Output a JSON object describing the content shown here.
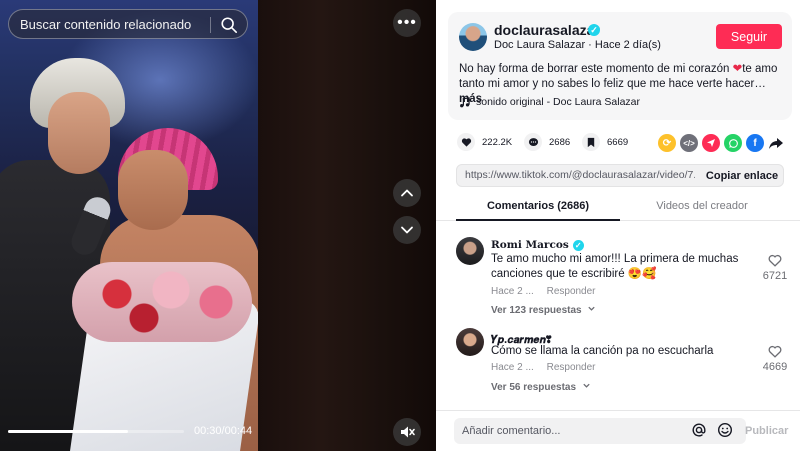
{
  "search": {
    "placeholder": "Buscar contenido relacionado"
  },
  "video": {
    "time": "00:30/00:44",
    "progress": 0.68
  },
  "author": {
    "username": "doclaurasalazar",
    "meta": "Doc Laura Salazar · Hace 2 día(s)",
    "follow_label": "Seguir"
  },
  "post": {
    "desc_part1": "No hay forma de borrar este momento de mi corazón ",
    "desc_heart": "❤",
    "desc_part2": "te amo tanto mi amor y no sabes lo feliz que me hace verte hacer…",
    "desc_more": "más",
    "music": "sonido original - Doc Laura Salazar"
  },
  "stats": {
    "likes": "222.2K",
    "comments": "2686",
    "saves": "6669"
  },
  "link": {
    "url": "https://www.tiktok.com/@doclaurasalazar/video/7...",
    "copy_label": "Copiar enlace"
  },
  "tabs": {
    "comments": "Comentarios (2686)",
    "creator": "Videos del creador"
  },
  "comments": [
    {
      "name": "Romi Marcos",
      "text": "Te amo mucho mi amor!!! La primera de muchas canciones que te escribiré 😍🥰",
      "time": "Hace 2 ...",
      "reply": "Responder",
      "likes": "6721",
      "replies": "Ver 123 respuestas"
    },
    {
      "name": "𝒀𝒑.𝒄𝒂𝒓𝒎𝒆𝒏❣",
      "text": "Cómo se llama la canción pa no escucharla",
      "time": "Hace 2 ...",
      "reply": "Responder",
      "likes": "4669",
      "replies": "Ver 56 respuestas"
    }
  ],
  "composer": {
    "placeholder": "Añadir comentario...",
    "publish": "Publicar"
  },
  "colors": {
    "accent": "#fe2c55",
    "verified": "#20d5ec"
  }
}
